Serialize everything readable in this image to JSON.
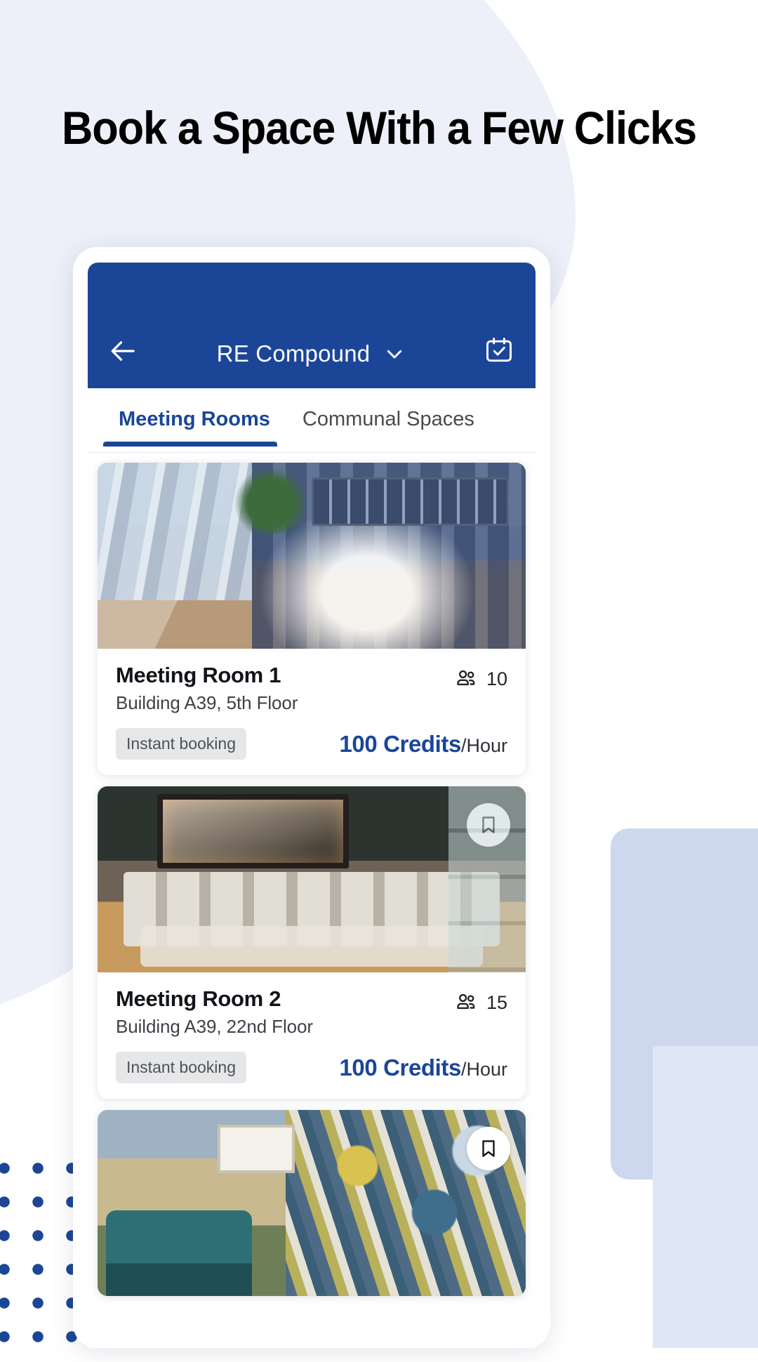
{
  "headline": "Book a Space With a Few Clicks",
  "brand_colors": {
    "primary_blue": "#1b4698",
    "bg_lavender": "#edf0f9",
    "badge_gray": "#e6e7e9",
    "accent_light_blue": "#cdd7ee"
  },
  "app": {
    "header": {
      "back_icon": "arrow-left-icon",
      "title": "RE Compound",
      "dropdown_icon": "chevron-down-icon",
      "calendar_icon": "calendar-check-icon"
    },
    "tabs": [
      {
        "label": "Meeting Rooms",
        "active": true
      },
      {
        "label": "Communal Spaces",
        "active": false
      }
    ],
    "cards": [
      {
        "name": "Meeting Room 1",
        "location": "Building A39, 5th Floor",
        "badge": "Instant booking",
        "capacity": "10",
        "capacity_icon": "people-group-icon",
        "bookmark_icon": "bookmark-icon",
        "price_main": "100 Credits",
        "price_unit": "/Hour",
        "photo": "photo-room1"
      },
      {
        "name": "Meeting Room 2",
        "location": "Building A39, 22nd Floor",
        "badge": "Instant booking",
        "capacity": "15",
        "capacity_icon": "people-group-icon",
        "bookmark_icon": "bookmark-icon",
        "price_main": "100 Credits",
        "price_unit": "/Hour",
        "photo": "photo-room2"
      },
      {
        "name": "",
        "location": "",
        "badge": "",
        "capacity": "",
        "capacity_icon": "people-group-icon",
        "bookmark_icon": "bookmark-icon",
        "price_main": "",
        "price_unit": "",
        "photo": "photo-room3"
      }
    ]
  }
}
